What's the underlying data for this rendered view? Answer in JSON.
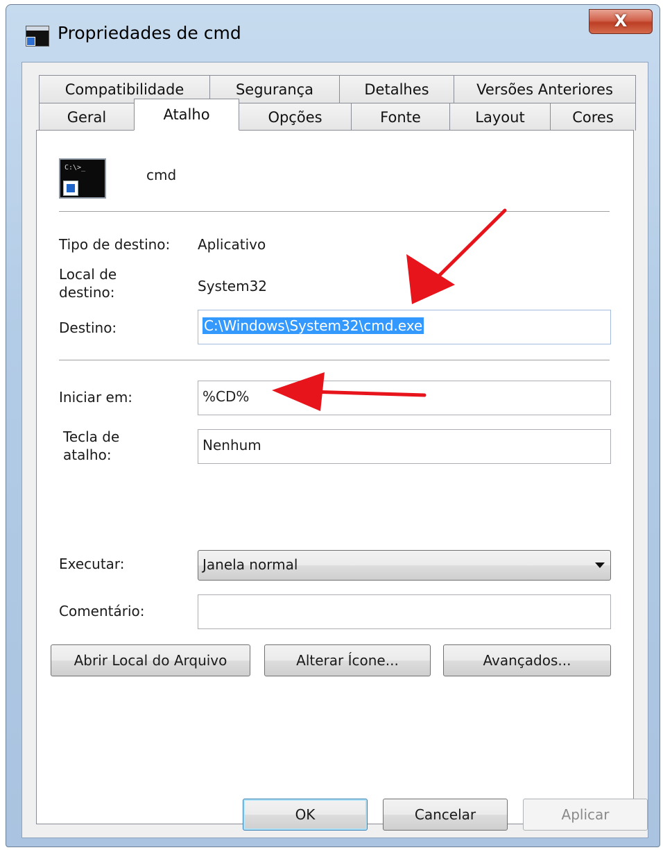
{
  "window": {
    "title": "Propriedades de cmd",
    "close_label": "X"
  },
  "tabs_top": [
    {
      "label": "Compatibilidade"
    },
    {
      "label": "Segurança"
    },
    {
      "label": "Detalhes"
    },
    {
      "label": "Versões Anteriores"
    }
  ],
  "tabs_bottom": [
    {
      "label": "Geral"
    },
    {
      "label": "Atalho",
      "active": true
    },
    {
      "label": "Opções"
    },
    {
      "label": "Fonte"
    },
    {
      "label": "Layout"
    },
    {
      "label": "Cores"
    }
  ],
  "shortcut": {
    "icon_prompt": "C:\\>_",
    "name": "cmd",
    "target_type_label": "Tipo de destino:",
    "target_type_value": "Aplicativo",
    "target_location_label": "Local de destino:",
    "target_location_value": "System32",
    "target_label": "Destino:",
    "target_value": "C:\\Windows\\System32\\cmd.exe",
    "start_in_label": "Iniciar em:",
    "start_in_value": "%CD%",
    "hotkey_label": "Tecla de atalho:",
    "hotkey_value": "Nenhum",
    "run_label": "Executar:",
    "run_value": "Janela normal",
    "comment_label": "Comentário:",
    "comment_value": ""
  },
  "buttons": {
    "open_location": "Abrir Local do Arquivo",
    "change_icon": "Alterar Ícone...",
    "advanced": "Avançados...",
    "ok": "OK",
    "cancel": "Cancelar",
    "apply": "Aplicar"
  },
  "colors": {
    "annotation_arrow": "#e8141b",
    "selection": "#3399ff"
  }
}
